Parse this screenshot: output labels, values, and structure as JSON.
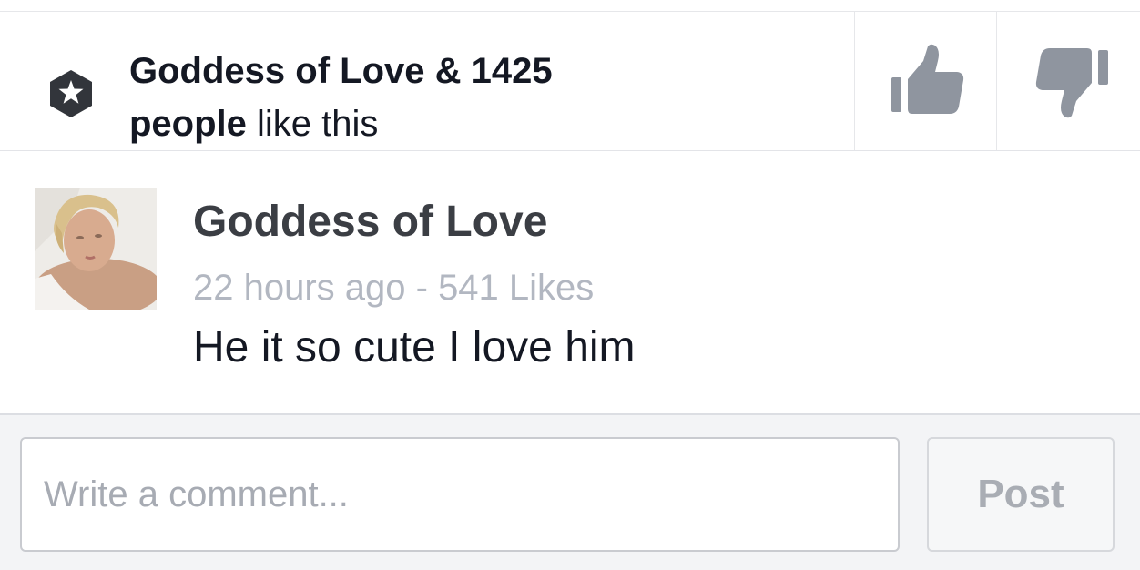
{
  "likes_bar": {
    "liker_name": "Goddess of Love",
    "connector": " & ",
    "count": "1425",
    "people_word": "people",
    "suffix": " like this",
    "badge_icon": "star-badge-icon",
    "upvote_icon": "thumbs-up-icon",
    "downvote_icon": "thumbs-down-icon",
    "icon_color": "#8f959f"
  },
  "comment": {
    "author": "Goddess of Love",
    "time": "22 hours ago",
    "separator": " - ",
    "likes": "541 Likes",
    "text": "He it so cute I love him",
    "avatar_icon": "profile-photo"
  },
  "composer": {
    "placeholder": "Write a comment...",
    "value": "",
    "post_label": "Post"
  }
}
